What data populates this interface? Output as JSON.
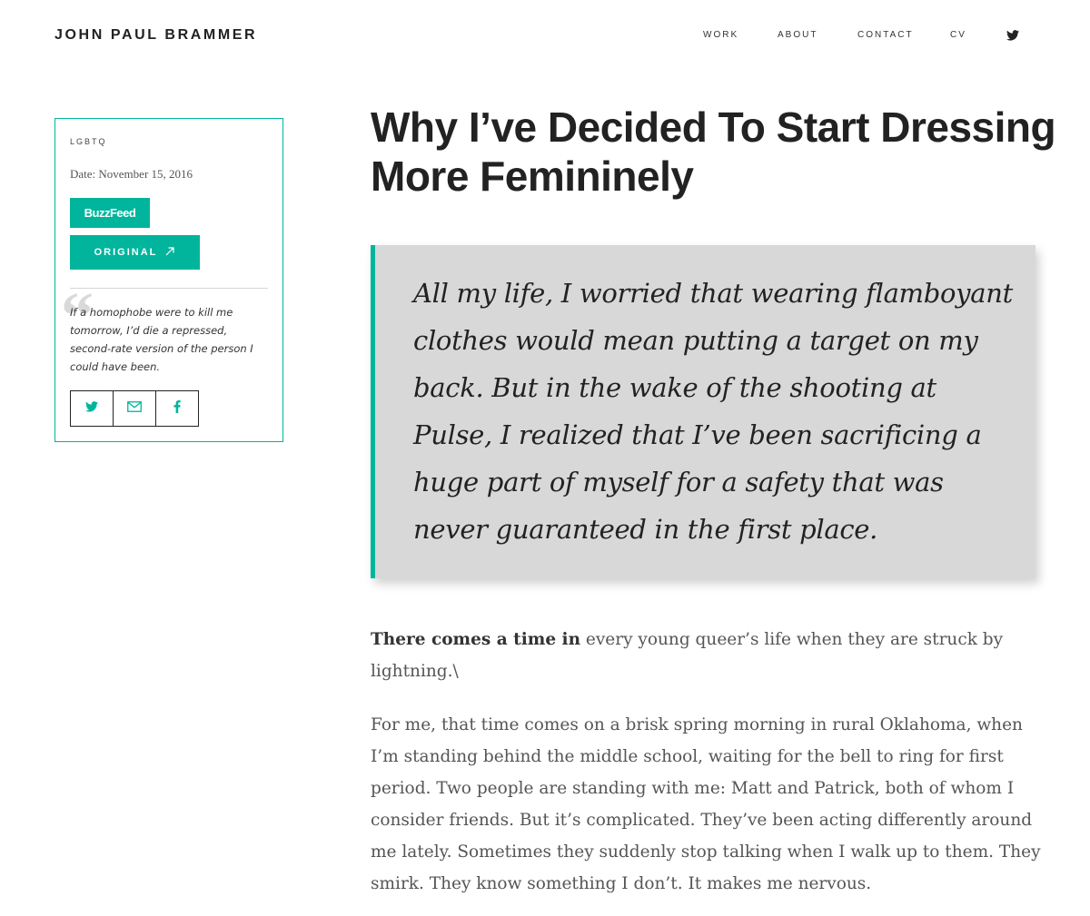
{
  "header": {
    "site_title": "JOHN PAUL BRAMMER",
    "nav": [
      {
        "label": "WORK"
      },
      {
        "label": "ABOUT"
      },
      {
        "label": "CONTACT"
      },
      {
        "label": "CV"
      }
    ],
    "twitter_icon": "twitter-icon"
  },
  "sidebar": {
    "category": "LGBTQ",
    "date": "Date: November 15, 2016",
    "publication_label": "BuzzFeed",
    "original_label": "ORIGINAL",
    "original_icon": "external-link-icon",
    "quote": "If a homophobe were to kill me tomorrow, I’d die a repressed, second-rate version of the person I could have been.",
    "quote_mark": "“",
    "share_icons": [
      "twitter-icon",
      "email-icon",
      "facebook-icon"
    ]
  },
  "article": {
    "title": "Why I’ve Decided To Start Dressing More Femininely",
    "pullquote": "All my life, I worried that wearing flamboyant clothes would mean putting a target on my back. But in the wake of the shooting at Pulse, I realized that I’ve been sacrificing a huge part of myself for a safety that was never guaranteed in the first place.",
    "para1_lead": "There comes a time in",
    "para1_rest": " every young queer’s life when they are struck by lightning.\\",
    "para2": "For me, that time comes on a brisk spring morning in rural Oklahoma, when I’m standing behind the middle school, waiting for the bell to ring for first period. Two people are standing with me: Matt and Patrick, both of whom I consider friends. But it’s complicated. They’ve been acting differently around me lately. Sometimes they suddenly stop talking when I walk up to them. They smirk. They know something I don’t. It makes me nervous."
  },
  "colors": {
    "accent": "#00b59c",
    "pullquote_bg": "#d8d8d8",
    "text": "#222222",
    "body_text": "#555555"
  }
}
